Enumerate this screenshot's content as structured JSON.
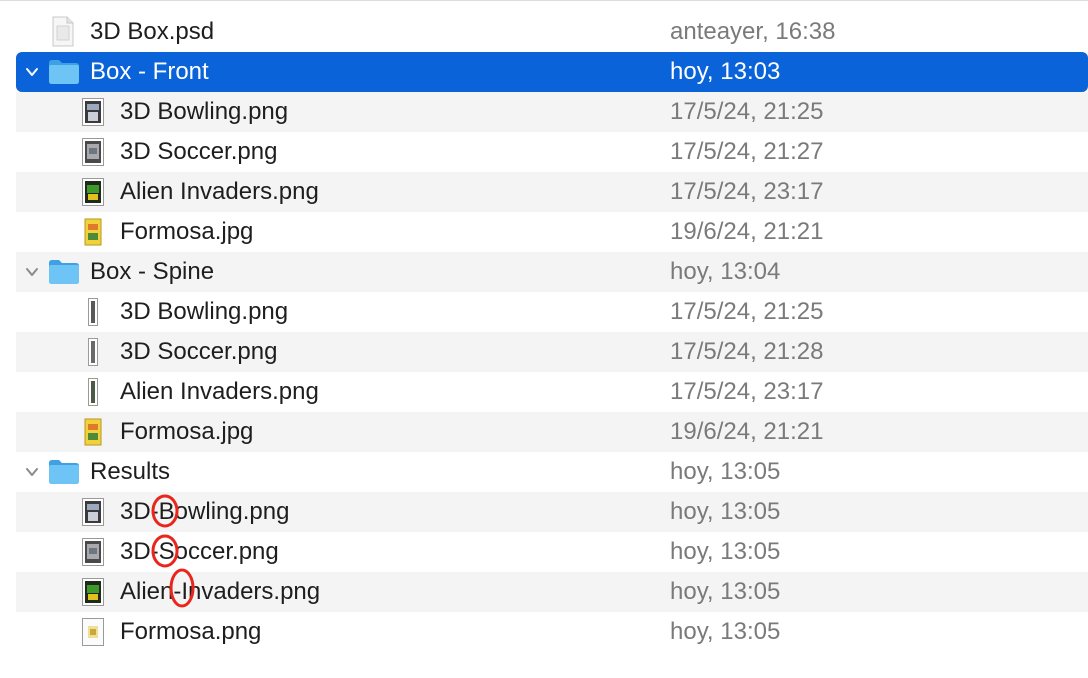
{
  "rows": [
    {
      "name": "3D Box.psd",
      "date": "anteayer, 16:38",
      "kind": "psd-file-icon"
    },
    {
      "name": "Box - Front",
      "date": "hoy, 13:03",
      "kind": "folder-icon",
      "expanded": true,
      "selected": true
    },
    {
      "name": "3D Bowling.png",
      "date": "17/5/24, 21:25",
      "kind": "image-thumbnail-icon"
    },
    {
      "name": "3D Soccer.png",
      "date": "17/5/24, 21:27",
      "kind": "image-thumbnail-icon"
    },
    {
      "name": "Alien Invaders.png",
      "date": "17/5/24, 23:17",
      "kind": "image-thumbnail-icon"
    },
    {
      "name": "Formosa.jpg",
      "date": "19/6/24, 21:21",
      "kind": "image-thumbnail-icon"
    },
    {
      "name": "Box - Spine",
      "date": "hoy, 13:04",
      "kind": "folder-icon",
      "expanded": true
    },
    {
      "name": "3D Bowling.png",
      "date": "17/5/24, 21:25",
      "kind": "spine-thumbnail-icon"
    },
    {
      "name": "3D Soccer.png",
      "date": "17/5/24, 21:28",
      "kind": "spine-thumbnail-icon"
    },
    {
      "name": "Alien Invaders.png",
      "date": "17/5/24, 23:17",
      "kind": "spine-thumbnail-icon"
    },
    {
      "name": "Formosa.jpg",
      "date": "19/6/24, 21:21",
      "kind": "image-thumbnail-icon"
    },
    {
      "name": "Results",
      "date": "hoy, 13:05",
      "kind": "folder-icon",
      "expanded": true
    },
    {
      "name": "3D-Bowling.png",
      "date": "hoy, 13:05",
      "kind": "image-thumbnail-icon"
    },
    {
      "name": "3D-Soccer.png",
      "date": "hoy, 13:05",
      "kind": "image-thumbnail-icon"
    },
    {
      "name": "Alien-Invaders.png",
      "date": "hoy, 13:05",
      "kind": "image-thumbnail-icon"
    },
    {
      "name": "Formosa.png",
      "date": "hoy, 13:05",
      "kind": "image-thumbnail-icon"
    }
  ],
  "colors": {
    "selection": "#0a63d8",
    "folder": "#5bb8f0",
    "annotation": "#e8261c"
  }
}
